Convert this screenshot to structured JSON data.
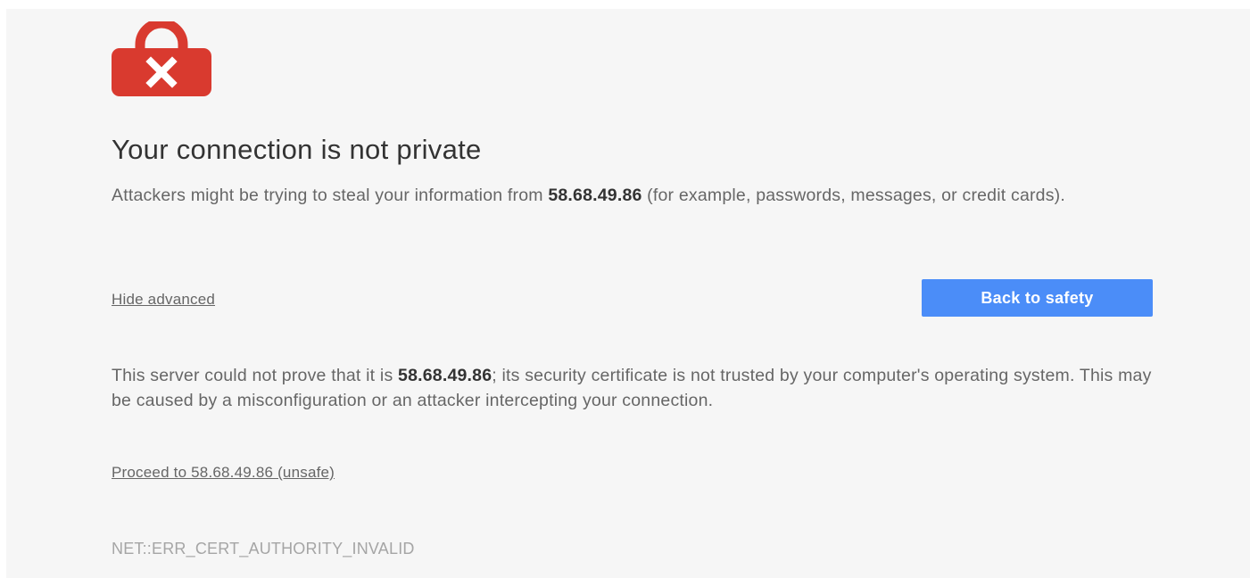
{
  "icon": "lock-red-x-icon",
  "colors": {
    "page_background": "#f6f6f6",
    "lock_red": "#d93a2f",
    "button_blue": "#4b8df8",
    "button_text": "#ffffff",
    "heading_text": "#333333",
    "body_text": "#666666",
    "error_code_text": "#a5a5a5"
  },
  "heading": "Your connection is not private",
  "intro": {
    "before": "Attackers might be trying to steal your information from ",
    "host": "58.68.49.86",
    "after": " (for example, passwords, messages, or credit cards)."
  },
  "hide_advanced_link": "Hide advanced",
  "back_button": "Back to safety",
  "details": {
    "before": "This server could not prove that it is ",
    "host": "58.68.49.86",
    "after": "; its security certificate is not trusted by your computer's operating system. This may be caused by a misconfiguration or an attacker intercepting your connection."
  },
  "proceed_link": "Proceed to 58.68.49.86 (unsafe)",
  "error_code": "NET::ERR_CERT_AUTHORITY_INVALID"
}
